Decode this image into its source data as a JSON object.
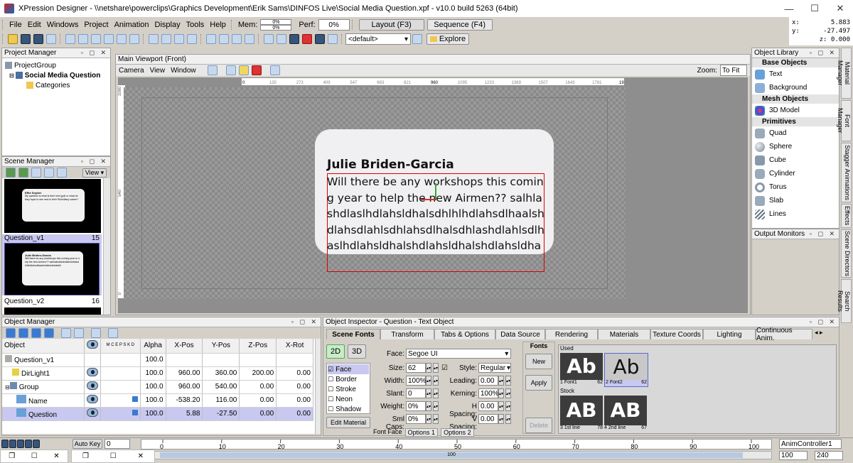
{
  "window": {
    "title": "XPression Designer - \\\\netshare\\powerclips\\Graphics Development\\Erik Sams\\DINFOS Live\\Social Media Question.xpf - v10.0 build 5263 (64bit)",
    "minimize": "—",
    "maximize": "☐",
    "close": "✕"
  },
  "menu": [
    "File",
    "Edit",
    "Windows",
    "Project",
    "Animation",
    "Display",
    "Tools",
    "Help"
  ],
  "perf_bar": {
    "mem_label": "Mem:",
    "mem_values": [
      "0%",
      "0%"
    ],
    "perf_label": "Perf:",
    "perf_value": "0%",
    "layout_button": "Layout (F3)",
    "sequence_button": "Sequence (F4)"
  },
  "coords": {
    "x_label": "x:",
    "x": "5.883",
    "y_label": "y:",
    "y": "-27.497",
    "z_label": "z:",
    "z": "0.000"
  },
  "toolbar": {
    "preset_select": "<default>",
    "explore_button": "Explore"
  },
  "project_manager": {
    "title": "Project Manager",
    "items": [
      {
        "label": "ProjectGroup",
        "indent": 0,
        "bold": false
      },
      {
        "label": "Social Media Question",
        "indent": 1,
        "bold": true
      },
      {
        "label": "Categories",
        "indent": 2,
        "bold": false
      }
    ]
  },
  "scene_manager": {
    "title": "Scene Manager",
    "view_button": "View",
    "scenes": [
      {
        "name": "",
        "number": "",
        "preview_name": "Effie Snyder",
        "preview_text": "My question is what is their next goal or what do they hope to see next in their PA/military career?"
      },
      {
        "name": "Question_v1",
        "number": "15",
        "preview_name": "Julie Briden-Garcia",
        "preview_text": "Will there be any workshops this coming year to help the new Airmen?? salhlashdlaslhdlahsldhalsdhlhlhdlahsdlhaalshdlahsdlahlsdhl"
      },
      {
        "name": "Question_v2",
        "number": "16",
        "preview_name": "",
        "preview_text": ""
      }
    ]
  },
  "viewport": {
    "title": "Main Viewport (Front)",
    "menu": [
      "Camera",
      "View",
      "Window"
    ],
    "zoom_label": "Zoom:",
    "zoom_value": "To Fit",
    "ruler_top": [
      "0",
      "135",
      "273",
      "409",
      "547",
      "683",
      "821",
      "960",
      "1095",
      "1233",
      "1369",
      "1507",
      "1643",
      "1781",
      "1920"
    ],
    "ruler_left": [
      "1080",
      "540",
      "0"
    ],
    "card_name": "Julie Briden-Garcia",
    "card_question": "Will there be any workshops this coming year to help the new Airmen?? salhlashdlaslhdlahsldhalsdhlhlhdlahsdlhaalshdlahsdlahlsdhlahsdlhalsdhlashdlahlsdlhaslhdlahsldhalshdlahsldhalshdlahsldha"
  },
  "object_library": {
    "title": "Object Library",
    "sections": [
      {
        "name": "Base Objects",
        "items": [
          "Text",
          "Background"
        ]
      },
      {
        "name": "Mesh Objects",
        "items": [
          "3D Model"
        ]
      },
      {
        "name": "Primitives",
        "items": [
          "Quad",
          "Sphere",
          "Cube",
          "Cylinder",
          "Torus",
          "Slab",
          "Lines"
        ]
      }
    ],
    "output_monitors": "Output Monitors"
  },
  "side_tabs": [
    "Material Manager",
    "Font Manager",
    "Stagger Animations",
    "Effects",
    "Scene Directors",
    "Search Results"
  ],
  "object_manager": {
    "title": "Object Manager",
    "columns": [
      "Object",
      "",
      "",
      "Alpha",
      "X-Pos",
      "Y-Pos",
      "Z-Pos",
      "X-Rot"
    ],
    "col_codes": "M C E P S K D",
    "rows": [
      {
        "name": "Question_v1",
        "indent": 0,
        "eye": false,
        "alpha": "100.0",
        "x": "",
        "y": "",
        "z": "",
        "xrot": "",
        "selected": false
      },
      {
        "name": "DirLight1",
        "indent": 1,
        "eye": true,
        "alpha": "100.0",
        "x": "960.00",
        "y": "360.00",
        "z": "200.00",
        "xrot": "0.00",
        "selected": false
      },
      {
        "name": "Group",
        "indent": 1,
        "eye": true,
        "alpha": "100.0",
        "x": "960.00",
        "y": "540.00",
        "z": "0.00",
        "xrot": "0.00",
        "selected": false
      },
      {
        "name": "Name",
        "indent": 2,
        "eye": true,
        "alpha": "100.0",
        "x": "-538.20",
        "y": "116.00",
        "z": "0.00",
        "xrot": "0.00",
        "selected": false
      },
      {
        "name": "Question",
        "indent": 2,
        "eye": true,
        "alpha": "100.0",
        "x": "5.88",
        "y": "-27.50",
        "z": "0.00",
        "xrot": "0.00",
        "selected": true
      }
    ]
  },
  "object_inspector": {
    "title": "Object Inspector - Question - Text Object",
    "tabs": [
      "Scene Fonts",
      "Transform",
      "Tabs & Options",
      "Data Source",
      "Rendering",
      "Materials",
      "Texture Coords",
      "Lighting",
      "Continuous Anim."
    ],
    "mode_2d": "2D",
    "mode_3d": "3D",
    "layers": [
      "Face",
      "Border",
      "Stroke",
      "Neon",
      "Shadow"
    ],
    "edit_material": "Edit Material",
    "face_label": "Face:",
    "face_value": "Segoe UI",
    "size_label": "Size:",
    "size_value": "62",
    "width_label": "Width:",
    "width_value": "100%",
    "slant_label": "Slant:",
    "slant_value": "0",
    "weight_label": "Weight:",
    "weight_value": "0%",
    "smlcaps_label": "Sml Caps:",
    "smlcaps_value": "0%",
    "style_label": "Style:",
    "style_value": "Regular",
    "leading_label": "Leading:",
    "leading_value": "0.00",
    "kerning_label": "Kerning:",
    "kerning_value": "100%",
    "hspacing_label": "H Spacing:",
    "hspacing_value": "0.00",
    "vspacing_label": "V Spacing:",
    "vspacing_value": "0.00",
    "bottom_tabs": [
      "Font Face",
      "Options 1",
      "Options 2"
    ],
    "fonts_title": "Fonts",
    "new_button": "New",
    "apply_button": "Apply",
    "delete_button": "Delete",
    "used_label": "Used",
    "stock_label": "Stock",
    "used_fonts": [
      {
        "glyph": "Ab",
        "name": "1 Font1",
        "size": "62"
      },
      {
        "glyph": "Ab",
        "name": "2 Font2",
        "size": "62"
      }
    ],
    "stock_fonts": [
      {
        "glyph": "AB",
        "name": "3 1st line",
        "size": "78"
      },
      {
        "glyph": "AB",
        "name": "4 2nd line",
        "size": "67"
      }
    ]
  },
  "timeline": {
    "autokey": "Auto Key",
    "frame_value": "0",
    "ticks": [
      "0",
      "10",
      "20",
      "30",
      "40",
      "50",
      "60",
      "70",
      "80",
      "90",
      "100"
    ],
    "scroll_value": "100",
    "controller": "AnimController1",
    "range_start": "100",
    "range_end": "240"
  }
}
